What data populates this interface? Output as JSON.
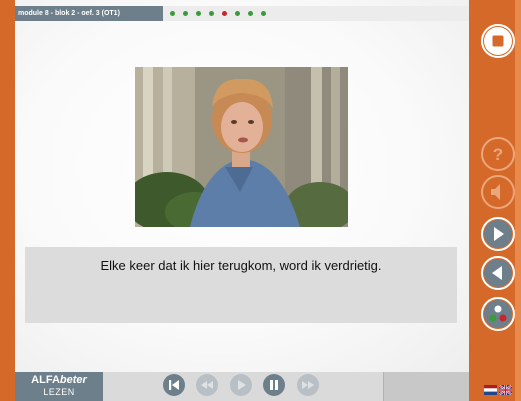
{
  "header": {
    "module_label": "module 8 - blok 2 - oef. 3 (OT1)",
    "progress": {
      "total": 8,
      "current": 5,
      "done_color": "#3b9a3b",
      "current_color": "#c9252b"
    }
  },
  "video": {
    "description_icon": "video-frame"
  },
  "sentence": "Elke keer dat ik hier terugkom, word ik verdrietig.",
  "sidebar": {
    "buttons": [
      {
        "name": "stop-button",
        "icon": "stop-icon",
        "enabled": true
      },
      {
        "name": "help-button",
        "icon": "question-icon",
        "enabled": false
      },
      {
        "name": "audio-button",
        "icon": "speaker-icon",
        "enabled": false
      },
      {
        "name": "next-button",
        "icon": "arrow-right-icon",
        "enabled": true
      },
      {
        "name": "previous-button",
        "icon": "arrow-left-icon",
        "enabled": true
      },
      {
        "name": "feedback-button",
        "icon": "dots-icon",
        "enabled": true
      }
    ]
  },
  "brand": {
    "name_prefix": "ALFA",
    "name_suffix": "beter",
    "subtitle": "LEZEN"
  },
  "player": {
    "controls": [
      {
        "name": "rewind-start-button",
        "icon": "skip-back-icon",
        "enabled": true
      },
      {
        "name": "rewind-button",
        "icon": "rewind-icon",
        "enabled": false
      },
      {
        "name": "play-button",
        "icon": "play-icon",
        "enabled": false
      },
      {
        "name": "pause-button",
        "icon": "pause-icon",
        "enabled": true
      },
      {
        "name": "fast-forward-button",
        "icon": "fast-forward-icon",
        "enabled": false
      }
    ]
  },
  "languages": [
    "Dutch",
    "English"
  ],
  "colors": {
    "frame": "#d5692a",
    "panel": "#6e7f8c",
    "sentence_bg": "#dcdcdc"
  }
}
